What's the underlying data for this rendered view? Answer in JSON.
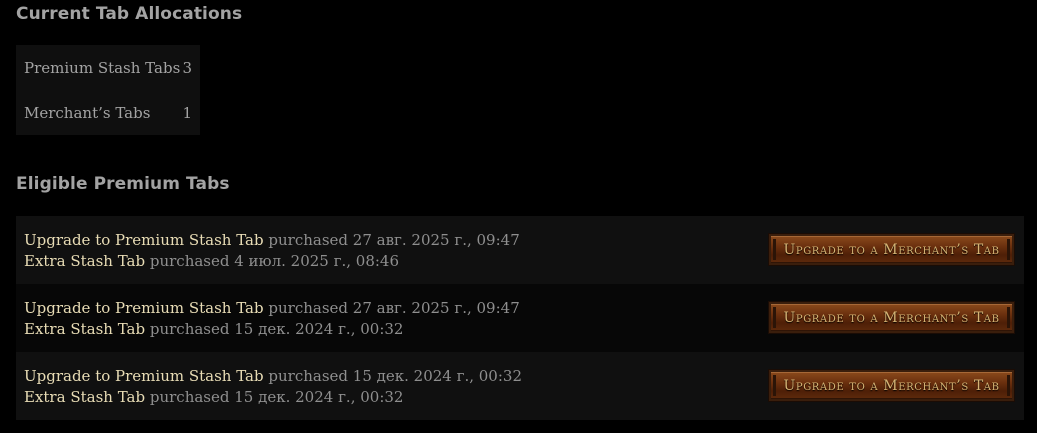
{
  "allocations": {
    "title": "Current Tab Allocations",
    "rows": [
      {
        "label": "Premium Stash Tabs",
        "count": "3"
      },
      {
        "label": "Merchant’s Tabs",
        "count": "1"
      }
    ]
  },
  "eligible": {
    "title": "Eligible Premium Tabs",
    "button_label": "Upgrade to a Merchant’s Tab",
    "rows": [
      {
        "line1": {
          "name": "Upgrade to Premium Stash Tab",
          "detail": "purchased 27 авг. 2025 г., 09:47"
        },
        "line2": {
          "name": "Extra Stash Tab",
          "detail": "purchased 4 июл. 2025 г., 08:46"
        }
      },
      {
        "line1": {
          "name": "Upgrade to Premium Stash Tab",
          "detail": "purchased 27 авг. 2025 г., 09:47"
        },
        "line2": {
          "name": "Extra Stash Tab",
          "detail": "purchased 15 дек. 2024 г., 00:32"
        }
      },
      {
        "line1": {
          "name": "Upgrade to Premium Stash Tab",
          "detail": "purchased 15 дек. 2024 г., 00:32"
        },
        "line2": {
          "name": "Extra Stash Tab",
          "detail": "purchased 15 дек. 2024 г., 00:32"
        }
      }
    ]
  },
  "colors": {
    "background": "#000000",
    "heading": "#a3a3a3",
    "item_name": "#e8dcb5",
    "detail_text": "#8f8f8f",
    "button_bg": "#6a2f0e",
    "button_text": "#d6b575"
  }
}
